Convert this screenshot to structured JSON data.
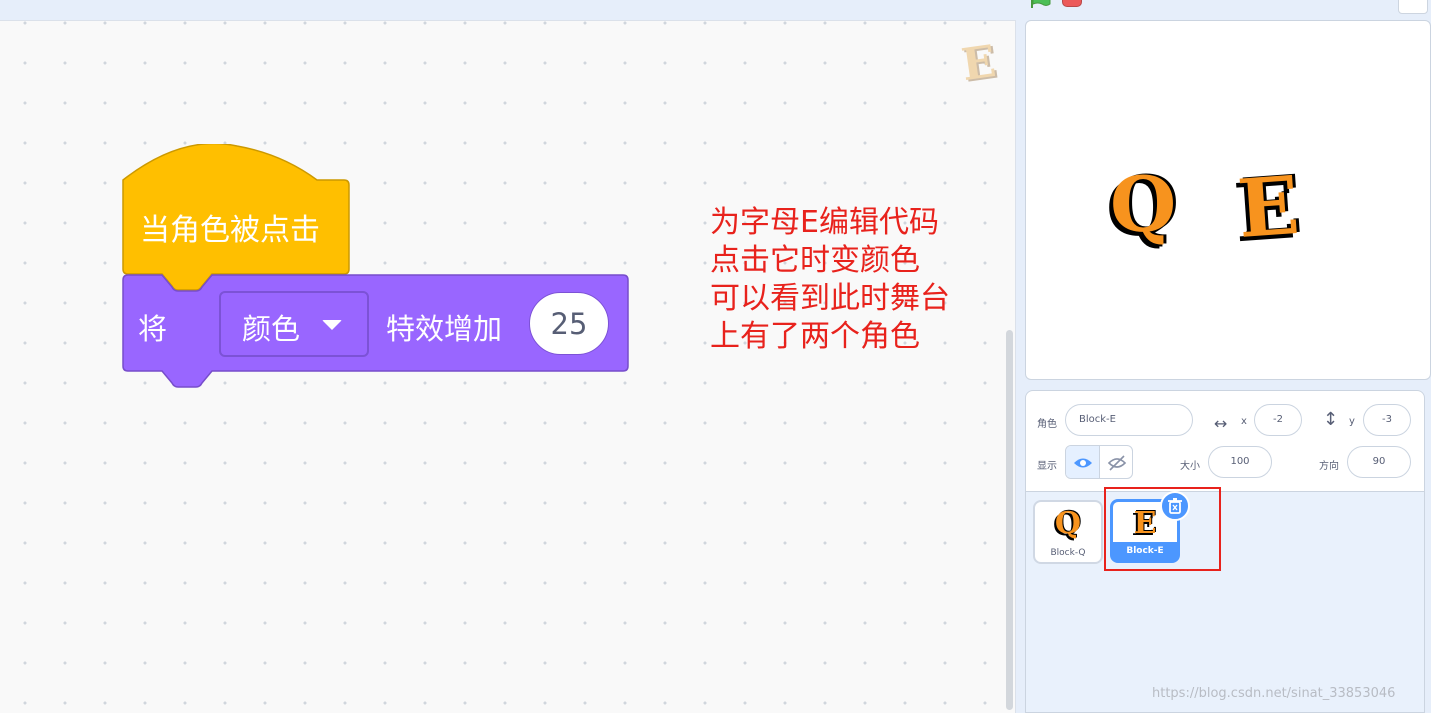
{
  "workspace": {
    "sprite_badge": "E",
    "hat_block": {
      "label": "当角色被点击",
      "color": "#ffbf00"
    },
    "command_block": {
      "prefix": "将",
      "dropdown": "颜色",
      "suffix": "特效增加",
      "value": "25",
      "color": "#9966ff"
    },
    "annotation": [
      "为字母E编辑代码",
      "点击它时变颜色",
      "可以看到此时舞台",
      "上有了两个角色"
    ]
  },
  "stage": {
    "sprites": [
      "Q",
      "E"
    ]
  },
  "sprite_info": {
    "sprite_label": "角色",
    "sprite_name": "Block-E",
    "x_label": "x",
    "x_value": "-2",
    "y_label": "y",
    "y_value": "-3",
    "show_label": "显示",
    "size_label": "大小",
    "size_value": "100",
    "direction_label": "方向",
    "direction_value": "90"
  },
  "sprite_list": [
    {
      "glyph": "Q",
      "name": "Block-Q",
      "selected": false
    },
    {
      "glyph": "E",
      "name": "Block-E",
      "selected": true
    }
  ],
  "watermark": "https://blog.csdn.net/sinat_33853046"
}
